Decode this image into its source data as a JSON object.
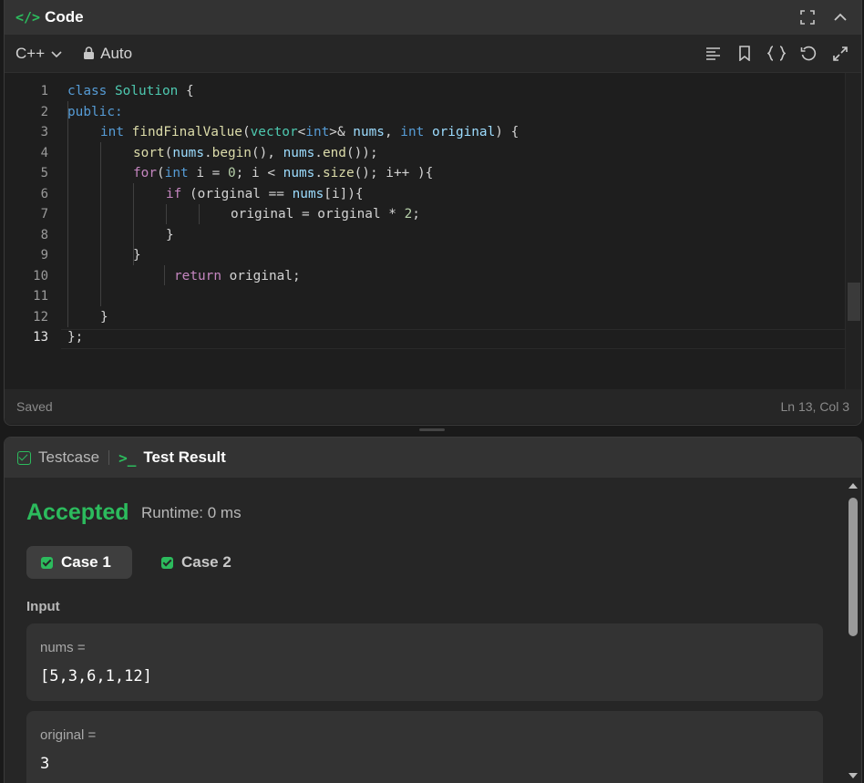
{
  "code_panel": {
    "title_icon": "</>",
    "title": "Code",
    "language": "C++",
    "mode": "Auto",
    "lines": [
      {
        "n": "1"
      },
      {
        "n": "2"
      },
      {
        "n": "3"
      },
      {
        "n": "4"
      },
      {
        "n": "5"
      },
      {
        "n": "6"
      },
      {
        "n": "7"
      },
      {
        "n": "8"
      },
      {
        "n": "9"
      },
      {
        "n": "10"
      },
      {
        "n": "11"
      },
      {
        "n": "12"
      },
      {
        "n": "13"
      }
    ],
    "code": {
      "l1_kw": "class",
      "l1_name": "Solution",
      "l1_rest": " {",
      "l2": "public:",
      "l3_t1": "int",
      "l3_fn": "findFinalValue",
      "l3_p1": "(",
      "l3_t2": "vector",
      "l3_p2": "<",
      "l3_t3": "int",
      "l3_p3": ">& ",
      "l3_v1": "nums",
      "l3_p4": ", ",
      "l3_t4": "int",
      "l3_p5": " ",
      "l3_v2": "original",
      "l3_p6": ") {",
      "l4_fn": "sort",
      "l4_p1": "(",
      "l4_v1": "nums",
      "l4_p2": ".",
      "l4_fn2": "begin",
      "l4_p3": "(), ",
      "l4_v2": "nums",
      "l4_p4": ".",
      "l4_fn3": "end",
      "l4_p5": "());",
      "l5_kw": "for",
      "l5_p1": "(",
      "l5_t": "int",
      "l5_p2": " i = ",
      "l5_n": "0",
      "l5_p3": "; i < ",
      "l5_v": "nums",
      "l5_p4": ".",
      "l5_fn": "size",
      "l5_p5": "(); i++ ){",
      "l6_kw": "if",
      "l6_p1": " (original == ",
      "l6_v": "nums",
      "l6_p2": "[i]){",
      "l7_p1": "original = original * ",
      "l7_n": "2",
      "l7_p2": ";",
      "l8": "}",
      "l9": "}",
      "l10_kw": "return",
      "l10_p": " original;",
      "l12": "}",
      "l13": "};"
    },
    "status_saved": "Saved",
    "status_position": "Ln 13, Col 3"
  },
  "result_panel": {
    "tab_testcase": "Testcase",
    "tab_result_icon": ">_",
    "tab_result": "Test Result",
    "verdict": "Accepted",
    "runtime": "Runtime: 0 ms",
    "cases": [
      "Case 1",
      "Case 2"
    ],
    "input_label": "Input",
    "inputs": [
      {
        "name": "nums =",
        "value": "[5,3,6,1,12]"
      },
      {
        "name": "original =",
        "value": "3"
      }
    ]
  },
  "colors": {
    "accent_green": "#2cbb5d",
    "bg": "#1e1e1e",
    "panel_header": "#333333"
  },
  "icons": [
    "code-icon",
    "maximize-icon",
    "collapse-icon",
    "chevron-down-icon",
    "lock-icon",
    "format-icon",
    "bookmark-icon",
    "braces-icon",
    "reset-icon",
    "expand-icon",
    "checkbox-icon",
    "terminal-icon"
  ]
}
